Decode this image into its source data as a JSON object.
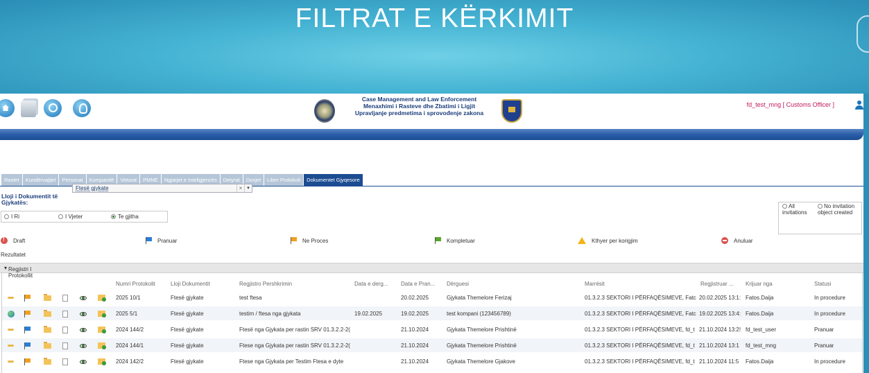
{
  "slide": {
    "title": "FILTRAT E KËRKIMIT"
  },
  "header": {
    "title_lines": [
      "Case Management and Law Enforcement",
      "Menaxhimi i Rasteve dhe Zbatimi i Ligjit",
      "Upravljanje predmetima i sprovođenje zakona"
    ],
    "user": "fd_test_mng [ Customs Officer ]",
    "toolbar_icons": [
      "home-icon",
      "documents-icon",
      "search-icon",
      "lightbulb-icon"
    ]
  },
  "tabs": [
    {
      "label": "Rastet"
    },
    {
      "label": "Kundërvajtjet"
    },
    {
      "label": "Personat"
    },
    {
      "label": "Kompanitë"
    },
    {
      "label": "Veturat"
    },
    {
      "label": "PMNE"
    },
    {
      "label": "Ngjarjet e Inteligjencës"
    },
    {
      "label": "Detyrat"
    },
    {
      "label": "Dosjet"
    },
    {
      "label": "Liber Protokoli"
    },
    {
      "label": "Dokumentet Gjyqesore"
    }
  ],
  "active_tab": "Dokumentet Gjyqesore",
  "filter": {
    "type_label": "Lloji i Dokumentit të Gjykatës:",
    "type_value": "Ftesë gjykate",
    "status_options": [
      {
        "label": "I Ri"
      },
      {
        "label": "I Vjeter"
      },
      {
        "label": "Te gjitha"
      }
    ],
    "status_selected": "Te gjitha",
    "invitation_options": [
      {
        "label": "All invitations"
      },
      {
        "label": "No invitation object created"
      }
    ]
  },
  "legend": [
    {
      "label": "Draft",
      "icon": "draft-icon"
    },
    {
      "label": "Pranuar",
      "icon": "blue-flag-icon"
    },
    {
      "label": "Ne Proces",
      "icon": "orange-flag-icon"
    },
    {
      "label": "Kompletuar",
      "icon": "green-flag-icon"
    },
    {
      "label": "Kthyer per korigjim",
      "icon": "warning-icon"
    },
    {
      "label": "Anuluar",
      "icon": "cancel-icon"
    }
  ],
  "results_label": "Rezultatet",
  "group_label": "Regjistri I Protokollit",
  "table": {
    "columns": [
      "Numri Protokolit",
      "Lloji Dokumentit",
      "Regjistro Pershkrimin",
      "Data e derg...",
      "Data e Pran...",
      "Dërguesi",
      "Marrësit",
      "Regjistruar ...",
      "Krijuar nga",
      "Statusi"
    ],
    "rows": [
      {
        "numri": "2025 10/1",
        "lloji": "Ftesë gjykate",
        "pershkrimi": "test ftesa",
        "data_derg": "",
        "data_pran": "20.02.2025",
        "derguesi": "Gjykata Themelore Ferizaj",
        "marresit": "01.3.2.3 SEKTORI I PËRFAQËSIMEVE, Fatc",
        "regjistruar": "20.02.2025 13:1:",
        "krijuar": "Fatos.Daija",
        "statusi": "In procedure",
        "lead_icon": "arrow",
        "flag": "orange"
      },
      {
        "numri": "2025 5/1",
        "lloji": "Ftesë gjykate",
        "pershkrimi": "testim / ftesa nga gjykata",
        "data_derg": "19.02.2025",
        "data_pran": "19.02.2025",
        "derguesi": "test kompani (123456789)",
        "marresit": "01.3.2.3 SEKTORI I PËRFAQËSIMEVE, Fatc",
        "regjistruar": "19.02.2025 13:4:",
        "krijuar": "Fatos.Daija",
        "statusi": "In procedure",
        "lead_icon": "globe",
        "flag": "orange"
      },
      {
        "numri": "2024 144/2",
        "lloji": "Ftesë gjykate",
        "pershkrimi": "Ftesë nga Gjykata per rastin SRV 01.3.2.2-2(",
        "data_derg": "",
        "data_pran": "21.10.2024",
        "derguesi": "Gjykata Themelore Prishtinë",
        "marresit": "01.3.2.3 SEKTORI I PËRFAQËSIMEVE, fd_t",
        "regjistruar": "21.10.2024 13:2!",
        "krijuar": "fd_test_user",
        "statusi": "Pranuar",
        "lead_icon": "arrow",
        "flag": "blue"
      },
      {
        "numri": "2024 144/1",
        "lloji": "Ftesë gjykate",
        "pershkrimi": "Ftese nga Gjykata per rastin SRV 01.3.2.2-2(",
        "data_derg": "",
        "data_pran": "21.10.2024",
        "derguesi": "Gjykata Themelore Prishtinë",
        "marresit": "01.3.2.3 SEKTORI I PËRFAQËSIMEVE, fd_t",
        "regjistruar": "21.10.2024 13:1",
        "krijuar": "fd_test_mng",
        "statusi": "Pranuar",
        "lead_icon": "arrow",
        "flag": "blue"
      },
      {
        "numri": "2024 142/2",
        "lloji": "Ftesë gjykate",
        "pershkrimi": "Ftese nga Gjykata per Testim Ftesa e dyte",
        "data_derg": "",
        "data_pran": "21.10.2024",
        "derguesi": "Gjykata Themelore Gjakove",
        "marresit": "01.3.2.3 SEKTORI I PËRFAQËSIMEVE, fd_t",
        "regjistruar": "21.10.2024 11:5",
        "krijuar": "Fatos.Daija",
        "statusi": "In procedure",
        "lead_icon": "arrow",
        "flag": "orange"
      }
    ]
  },
  "colors": {
    "accent": "#1c4c92",
    "slide_bg": "#45b3d3",
    "user": "#c2185b"
  }
}
